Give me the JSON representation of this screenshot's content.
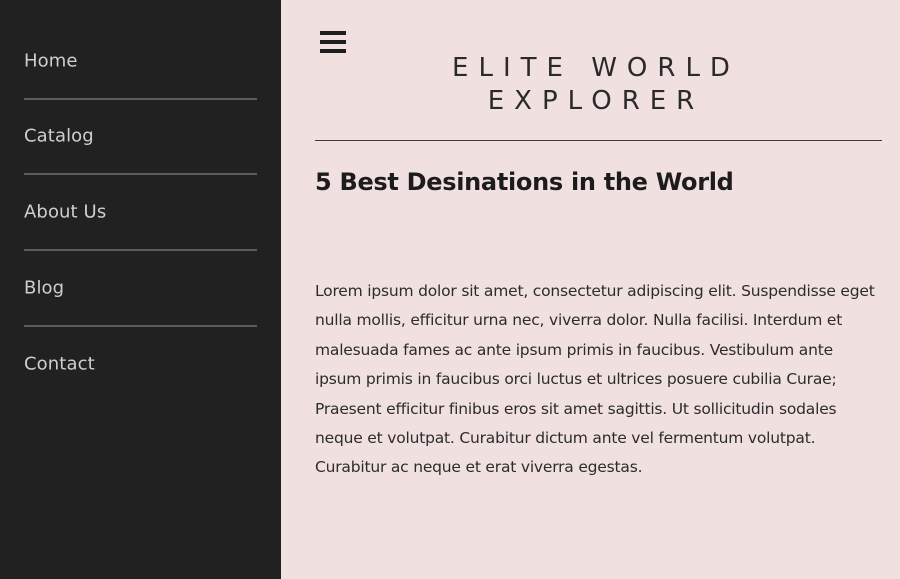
{
  "sidebar": {
    "items": [
      {
        "label": "Home"
      },
      {
        "label": "Catalog"
      },
      {
        "label": "About Us"
      },
      {
        "label": "Blog"
      },
      {
        "label": "Contact"
      }
    ]
  },
  "header": {
    "menu_icon": "hamburger-menu-icon",
    "site_title_line1": "ELITE WORLD",
    "site_title_line2": "EXPLORER"
  },
  "main": {
    "post_title": "5 Best Desinations in the World",
    "post_body": "Lorem ipsum dolor sit amet, consectetur adipiscing elit. Suspendisse eget nulla mollis, efficitur urna nec, viverra dolor. Nulla facilisi. Interdum et malesuada fames ac ante ipsum primis in faucibus. Vestibulum ante ipsum primis in faucibus orci luctus et ultrices posuere cubilia Curae; Praesent efficitur finibus eros sit amet sagittis. Ut sollicitudin sodales neque et volutpat. Curabitur dictum ante vel fermentum volutpat. Curabitur ac neque et erat viverra egestas."
  },
  "colors": {
    "sidebar_bg": "#212121",
    "main_bg": "#f1e0e0",
    "nav_text": "#cfcfcf",
    "heading_text": "#1c1c1c"
  }
}
